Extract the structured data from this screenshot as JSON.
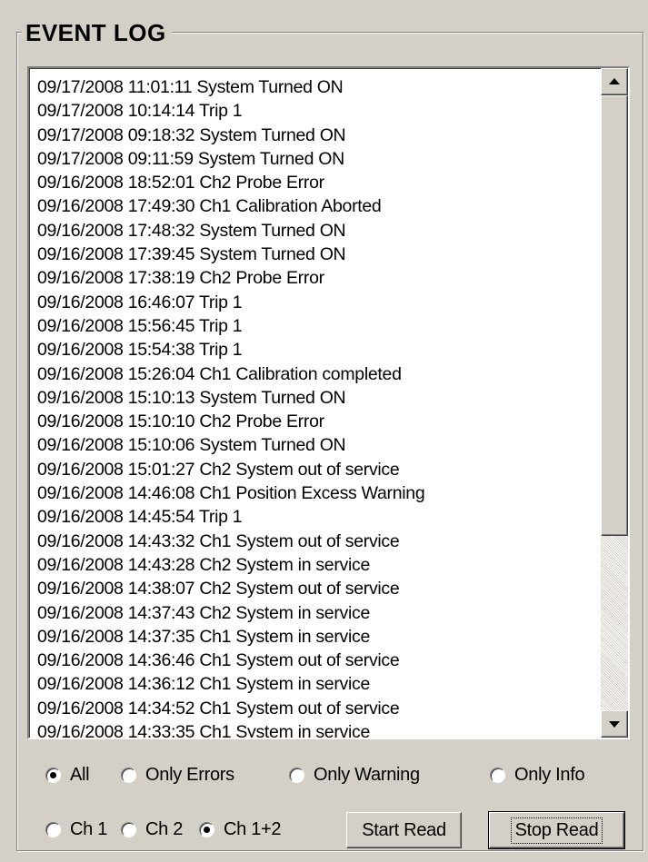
{
  "group": {
    "title": "EVENT LOG"
  },
  "log": {
    "rows": [
      "09/17/2008 11:01:11 System Turned ON",
      "09/17/2008 10:14:14 Trip 1",
      "09/17/2008 09:18:32 System Turned ON",
      "09/17/2008 09:11:59 System Turned ON",
      "09/16/2008 18:52:01 Ch2 Probe Error",
      "09/16/2008 17:49:30 Ch1 Calibration Aborted",
      "09/16/2008 17:48:32 System Turned ON",
      "09/16/2008 17:39:45 System Turned ON",
      "09/16/2008 17:38:19 Ch2 Probe Error",
      "09/16/2008 16:46:07 Trip 1",
      "09/16/2008 15:56:45 Trip 1",
      "09/16/2008 15:54:38 Trip 1",
      "09/16/2008 15:26:04 Ch1 Calibration completed",
      "09/16/2008 15:10:13 System Turned ON",
      "09/16/2008 15:10:10 Ch2 Probe Error",
      "09/16/2008 15:10:06 System Turned ON",
      "09/16/2008 15:01:27 Ch2 System out of service",
      "09/16/2008 14:46:08 Ch1 Position Excess Warning",
      "09/16/2008 14:45:54 Trip 1",
      "09/16/2008 14:43:32 Ch1 System out of service",
      "09/16/2008 14:43:28 Ch2 System in service",
      "09/16/2008 14:38:07 Ch2 System out of service",
      "09/16/2008 14:37:43 Ch2 System in service",
      "09/16/2008 14:37:35 Ch1 System in service",
      "09/16/2008 14:36:46 Ch1 System out of service",
      "09/16/2008 14:36:12 Ch1 System in service",
      "09/16/2008 14:34:52 Ch1 System out of service",
      "09/16/2008 14:33:35 Ch1 System in service"
    ]
  },
  "filters": {
    "type": [
      {
        "label": "All",
        "checked": true
      },
      {
        "label": "Only Errors",
        "checked": false
      },
      {
        "label": "Only Warning",
        "checked": false
      },
      {
        "label": "Only Info",
        "checked": false
      }
    ],
    "channel": [
      {
        "label": "Ch 1",
        "checked": false
      },
      {
        "label": "Ch 2",
        "checked": false
      },
      {
        "label": "Ch 1+2",
        "checked": true
      }
    ]
  },
  "buttons": {
    "start_read": "Start Read",
    "stop_read": "Stop Read"
  }
}
